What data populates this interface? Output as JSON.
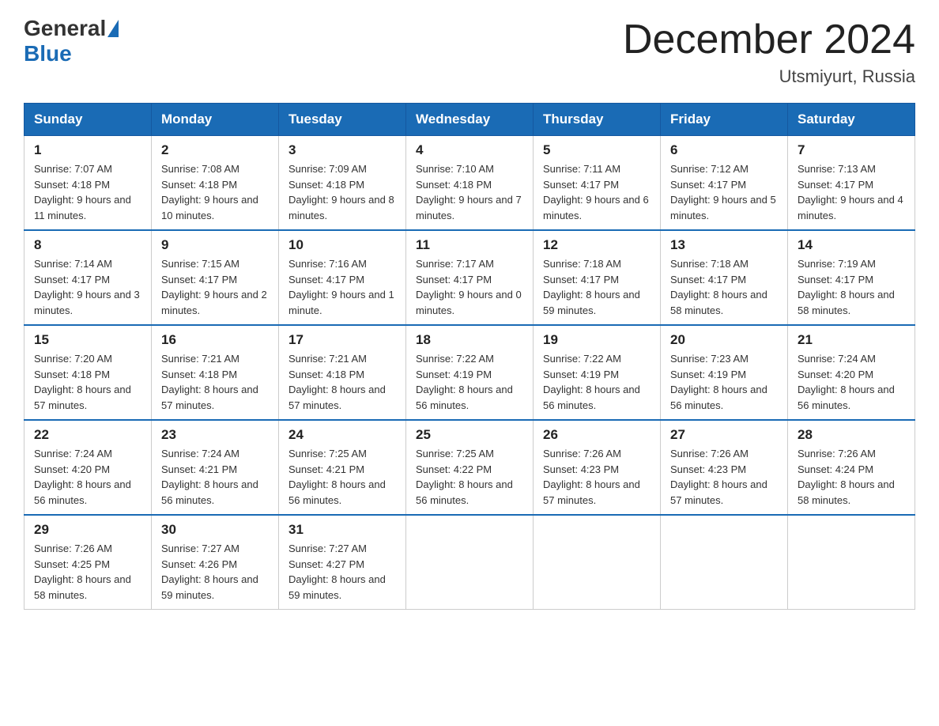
{
  "header": {
    "logo_general": "General",
    "logo_blue": "Blue",
    "month_title": "December 2024",
    "location": "Utsmiyurt, Russia"
  },
  "days_of_week": [
    "Sunday",
    "Monday",
    "Tuesday",
    "Wednesday",
    "Thursday",
    "Friday",
    "Saturday"
  ],
  "weeks": [
    [
      {
        "day": "1",
        "sunrise": "7:07 AM",
        "sunset": "4:18 PM",
        "daylight": "9 hours and 11 minutes."
      },
      {
        "day": "2",
        "sunrise": "7:08 AM",
        "sunset": "4:18 PM",
        "daylight": "9 hours and 10 minutes."
      },
      {
        "day": "3",
        "sunrise": "7:09 AM",
        "sunset": "4:18 PM",
        "daylight": "9 hours and 8 minutes."
      },
      {
        "day": "4",
        "sunrise": "7:10 AM",
        "sunset": "4:18 PM",
        "daylight": "9 hours and 7 minutes."
      },
      {
        "day": "5",
        "sunrise": "7:11 AM",
        "sunset": "4:17 PM",
        "daylight": "9 hours and 6 minutes."
      },
      {
        "day": "6",
        "sunrise": "7:12 AM",
        "sunset": "4:17 PM",
        "daylight": "9 hours and 5 minutes."
      },
      {
        "day": "7",
        "sunrise": "7:13 AM",
        "sunset": "4:17 PM",
        "daylight": "9 hours and 4 minutes."
      }
    ],
    [
      {
        "day": "8",
        "sunrise": "7:14 AM",
        "sunset": "4:17 PM",
        "daylight": "9 hours and 3 minutes."
      },
      {
        "day": "9",
        "sunrise": "7:15 AM",
        "sunset": "4:17 PM",
        "daylight": "9 hours and 2 minutes."
      },
      {
        "day": "10",
        "sunrise": "7:16 AM",
        "sunset": "4:17 PM",
        "daylight": "9 hours and 1 minute."
      },
      {
        "day": "11",
        "sunrise": "7:17 AM",
        "sunset": "4:17 PM",
        "daylight": "9 hours and 0 minutes."
      },
      {
        "day": "12",
        "sunrise": "7:18 AM",
        "sunset": "4:17 PM",
        "daylight": "8 hours and 59 minutes."
      },
      {
        "day": "13",
        "sunrise": "7:18 AM",
        "sunset": "4:17 PM",
        "daylight": "8 hours and 58 minutes."
      },
      {
        "day": "14",
        "sunrise": "7:19 AM",
        "sunset": "4:17 PM",
        "daylight": "8 hours and 58 minutes."
      }
    ],
    [
      {
        "day": "15",
        "sunrise": "7:20 AM",
        "sunset": "4:18 PM",
        "daylight": "8 hours and 57 minutes."
      },
      {
        "day": "16",
        "sunrise": "7:21 AM",
        "sunset": "4:18 PM",
        "daylight": "8 hours and 57 minutes."
      },
      {
        "day": "17",
        "sunrise": "7:21 AM",
        "sunset": "4:18 PM",
        "daylight": "8 hours and 57 minutes."
      },
      {
        "day": "18",
        "sunrise": "7:22 AM",
        "sunset": "4:19 PM",
        "daylight": "8 hours and 56 minutes."
      },
      {
        "day": "19",
        "sunrise": "7:22 AM",
        "sunset": "4:19 PM",
        "daylight": "8 hours and 56 minutes."
      },
      {
        "day": "20",
        "sunrise": "7:23 AM",
        "sunset": "4:19 PM",
        "daylight": "8 hours and 56 minutes."
      },
      {
        "day": "21",
        "sunrise": "7:24 AM",
        "sunset": "4:20 PM",
        "daylight": "8 hours and 56 minutes."
      }
    ],
    [
      {
        "day": "22",
        "sunrise": "7:24 AM",
        "sunset": "4:20 PM",
        "daylight": "8 hours and 56 minutes."
      },
      {
        "day": "23",
        "sunrise": "7:24 AM",
        "sunset": "4:21 PM",
        "daylight": "8 hours and 56 minutes."
      },
      {
        "day": "24",
        "sunrise": "7:25 AM",
        "sunset": "4:21 PM",
        "daylight": "8 hours and 56 minutes."
      },
      {
        "day": "25",
        "sunrise": "7:25 AM",
        "sunset": "4:22 PM",
        "daylight": "8 hours and 56 minutes."
      },
      {
        "day": "26",
        "sunrise": "7:26 AM",
        "sunset": "4:23 PM",
        "daylight": "8 hours and 57 minutes."
      },
      {
        "day": "27",
        "sunrise": "7:26 AM",
        "sunset": "4:23 PM",
        "daylight": "8 hours and 57 minutes."
      },
      {
        "day": "28",
        "sunrise": "7:26 AM",
        "sunset": "4:24 PM",
        "daylight": "8 hours and 58 minutes."
      }
    ],
    [
      {
        "day": "29",
        "sunrise": "7:26 AM",
        "sunset": "4:25 PM",
        "daylight": "8 hours and 58 minutes."
      },
      {
        "day": "30",
        "sunrise": "7:27 AM",
        "sunset": "4:26 PM",
        "daylight": "8 hours and 59 minutes."
      },
      {
        "day": "31",
        "sunrise": "7:27 AM",
        "sunset": "4:27 PM",
        "daylight": "8 hours and 59 minutes."
      },
      null,
      null,
      null,
      null
    ]
  ],
  "labels": {
    "sunrise": "Sunrise:",
    "sunset": "Sunset:",
    "daylight": "Daylight:"
  }
}
